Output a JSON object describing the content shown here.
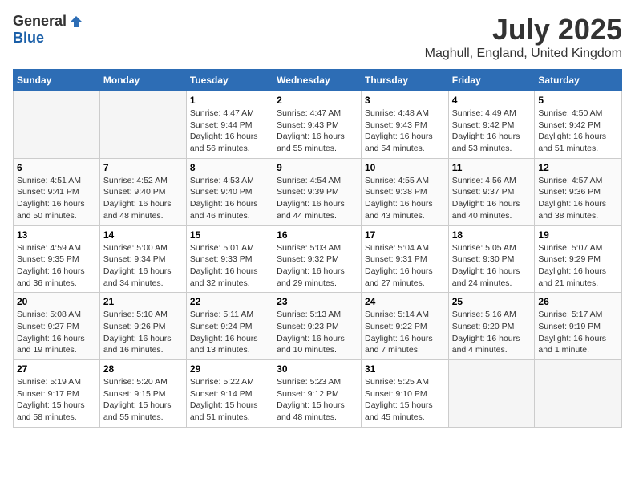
{
  "header": {
    "logo_general": "General",
    "logo_blue": "Blue",
    "month_year": "July 2025",
    "location": "Maghull, England, United Kingdom"
  },
  "weekdays": [
    "Sunday",
    "Monday",
    "Tuesday",
    "Wednesday",
    "Thursday",
    "Friday",
    "Saturday"
  ],
  "weeks": [
    [
      {
        "day": "",
        "empty": true
      },
      {
        "day": "",
        "empty": true
      },
      {
        "day": "1",
        "sunrise": "4:47 AM",
        "sunset": "9:44 PM",
        "daylight": "16 hours and 56 minutes."
      },
      {
        "day": "2",
        "sunrise": "4:47 AM",
        "sunset": "9:43 PM",
        "daylight": "16 hours and 55 minutes."
      },
      {
        "day": "3",
        "sunrise": "4:48 AM",
        "sunset": "9:43 PM",
        "daylight": "16 hours and 54 minutes."
      },
      {
        "day": "4",
        "sunrise": "4:49 AM",
        "sunset": "9:42 PM",
        "daylight": "16 hours and 53 minutes."
      },
      {
        "day": "5",
        "sunrise": "4:50 AM",
        "sunset": "9:42 PM",
        "daylight": "16 hours and 51 minutes."
      }
    ],
    [
      {
        "day": "6",
        "sunrise": "4:51 AM",
        "sunset": "9:41 PM",
        "daylight": "16 hours and 50 minutes."
      },
      {
        "day": "7",
        "sunrise": "4:52 AM",
        "sunset": "9:40 PM",
        "daylight": "16 hours and 48 minutes."
      },
      {
        "day": "8",
        "sunrise": "4:53 AM",
        "sunset": "9:40 PM",
        "daylight": "16 hours and 46 minutes."
      },
      {
        "day": "9",
        "sunrise": "4:54 AM",
        "sunset": "9:39 PM",
        "daylight": "16 hours and 44 minutes."
      },
      {
        "day": "10",
        "sunrise": "4:55 AM",
        "sunset": "9:38 PM",
        "daylight": "16 hours and 43 minutes."
      },
      {
        "day": "11",
        "sunrise": "4:56 AM",
        "sunset": "9:37 PM",
        "daylight": "16 hours and 40 minutes."
      },
      {
        "day": "12",
        "sunrise": "4:57 AM",
        "sunset": "9:36 PM",
        "daylight": "16 hours and 38 minutes."
      }
    ],
    [
      {
        "day": "13",
        "sunrise": "4:59 AM",
        "sunset": "9:35 PM",
        "daylight": "16 hours and 36 minutes."
      },
      {
        "day": "14",
        "sunrise": "5:00 AM",
        "sunset": "9:34 PM",
        "daylight": "16 hours and 34 minutes."
      },
      {
        "day": "15",
        "sunrise": "5:01 AM",
        "sunset": "9:33 PM",
        "daylight": "16 hours and 32 minutes."
      },
      {
        "day": "16",
        "sunrise": "5:03 AM",
        "sunset": "9:32 PM",
        "daylight": "16 hours and 29 minutes."
      },
      {
        "day": "17",
        "sunrise": "5:04 AM",
        "sunset": "9:31 PM",
        "daylight": "16 hours and 27 minutes."
      },
      {
        "day": "18",
        "sunrise": "5:05 AM",
        "sunset": "9:30 PM",
        "daylight": "16 hours and 24 minutes."
      },
      {
        "day": "19",
        "sunrise": "5:07 AM",
        "sunset": "9:29 PM",
        "daylight": "16 hours and 21 minutes."
      }
    ],
    [
      {
        "day": "20",
        "sunrise": "5:08 AM",
        "sunset": "9:27 PM",
        "daylight": "16 hours and 19 minutes."
      },
      {
        "day": "21",
        "sunrise": "5:10 AM",
        "sunset": "9:26 PM",
        "daylight": "16 hours and 16 minutes."
      },
      {
        "day": "22",
        "sunrise": "5:11 AM",
        "sunset": "9:24 PM",
        "daylight": "16 hours and 13 minutes."
      },
      {
        "day": "23",
        "sunrise": "5:13 AM",
        "sunset": "9:23 PM",
        "daylight": "16 hours and 10 minutes."
      },
      {
        "day": "24",
        "sunrise": "5:14 AM",
        "sunset": "9:22 PM",
        "daylight": "16 hours and 7 minutes."
      },
      {
        "day": "25",
        "sunrise": "5:16 AM",
        "sunset": "9:20 PM",
        "daylight": "16 hours and 4 minutes."
      },
      {
        "day": "26",
        "sunrise": "5:17 AM",
        "sunset": "9:19 PM",
        "daylight": "16 hours and 1 minute."
      }
    ],
    [
      {
        "day": "27",
        "sunrise": "5:19 AM",
        "sunset": "9:17 PM",
        "daylight": "15 hours and 58 minutes."
      },
      {
        "day": "28",
        "sunrise": "5:20 AM",
        "sunset": "9:15 PM",
        "daylight": "15 hours and 55 minutes."
      },
      {
        "day": "29",
        "sunrise": "5:22 AM",
        "sunset": "9:14 PM",
        "daylight": "15 hours and 51 minutes."
      },
      {
        "day": "30",
        "sunrise": "5:23 AM",
        "sunset": "9:12 PM",
        "daylight": "15 hours and 48 minutes."
      },
      {
        "day": "31",
        "sunrise": "5:25 AM",
        "sunset": "9:10 PM",
        "daylight": "15 hours and 45 minutes."
      },
      {
        "day": "",
        "empty": true
      },
      {
        "day": "",
        "empty": true
      }
    ]
  ]
}
